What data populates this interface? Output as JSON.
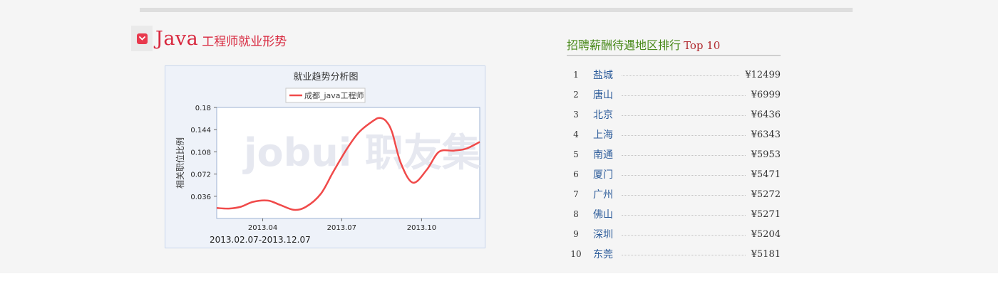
{
  "section": {
    "title_main": "Java",
    "title_sub": "工程师就业形势",
    "icon": "chevron-down-icon"
  },
  "chart_data": {
    "type": "line",
    "title": "就业趋势分析图",
    "ylabel": "相关职位比例",
    "xlabel": "",
    "date_range": "2013.02.07-2013.12.07",
    "ylim": [
      0.0,
      0.18
    ],
    "grid": false,
    "legend_position": "top-center",
    "yticks": [
      0.036,
      0.072,
      0.108,
      0.144,
      0.18
    ],
    "xticks": [
      "2013.04",
      "2013.07",
      "2013.10"
    ],
    "watermark": "jobui 职友集",
    "series": [
      {
        "name": "成都_java工程师",
        "color": "#f04a4a",
        "x": [
          "2013.02.07",
          "2013.02.21",
          "2013.03.07",
          "2013.03.21",
          "2013.04.07",
          "2013.04.21",
          "2013.05.07",
          "2013.05.21",
          "2013.06.07",
          "2013.06.21",
          "2013.07.07",
          "2013.07.21",
          "2013.08.07",
          "2013.08.14",
          "2013.08.21",
          "2013.08.28",
          "2013.09.07",
          "2013.09.21",
          "2013.10.07",
          "2013.10.21",
          "2013.11.07",
          "2013.11.21",
          "2013.12.07"
        ],
        "values": [
          0.017,
          0.016,
          0.019,
          0.027,
          0.029,
          0.022,
          0.014,
          0.019,
          0.04,
          0.075,
          0.113,
          0.14,
          0.159,
          0.163,
          0.158,
          0.14,
          0.09,
          0.058,
          0.079,
          0.108,
          0.11,
          0.113,
          0.124
        ]
      }
    ]
  },
  "ranking": {
    "title": "招聘薪酬待遇地区排行",
    "title_top": "Top 10",
    "items": [
      {
        "no": "1",
        "city": "盐城",
        "salary": "¥12499"
      },
      {
        "no": "2",
        "city": "唐山",
        "salary": "¥6999"
      },
      {
        "no": "3",
        "city": "北京",
        "salary": "¥6436"
      },
      {
        "no": "4",
        "city": "上海",
        "salary": "¥6343"
      },
      {
        "no": "5",
        "city": "南通",
        "salary": "¥5953"
      },
      {
        "no": "6",
        "city": "厦门",
        "salary": "¥5471"
      },
      {
        "no": "7",
        "city": "广州",
        "salary": "¥5272"
      },
      {
        "no": "8",
        "city": "佛山",
        "salary": "¥5271"
      },
      {
        "no": "9",
        "city": "深圳",
        "salary": "¥5204"
      },
      {
        "no": "10",
        "city": "东莞",
        "salary": "¥5181"
      }
    ]
  }
}
